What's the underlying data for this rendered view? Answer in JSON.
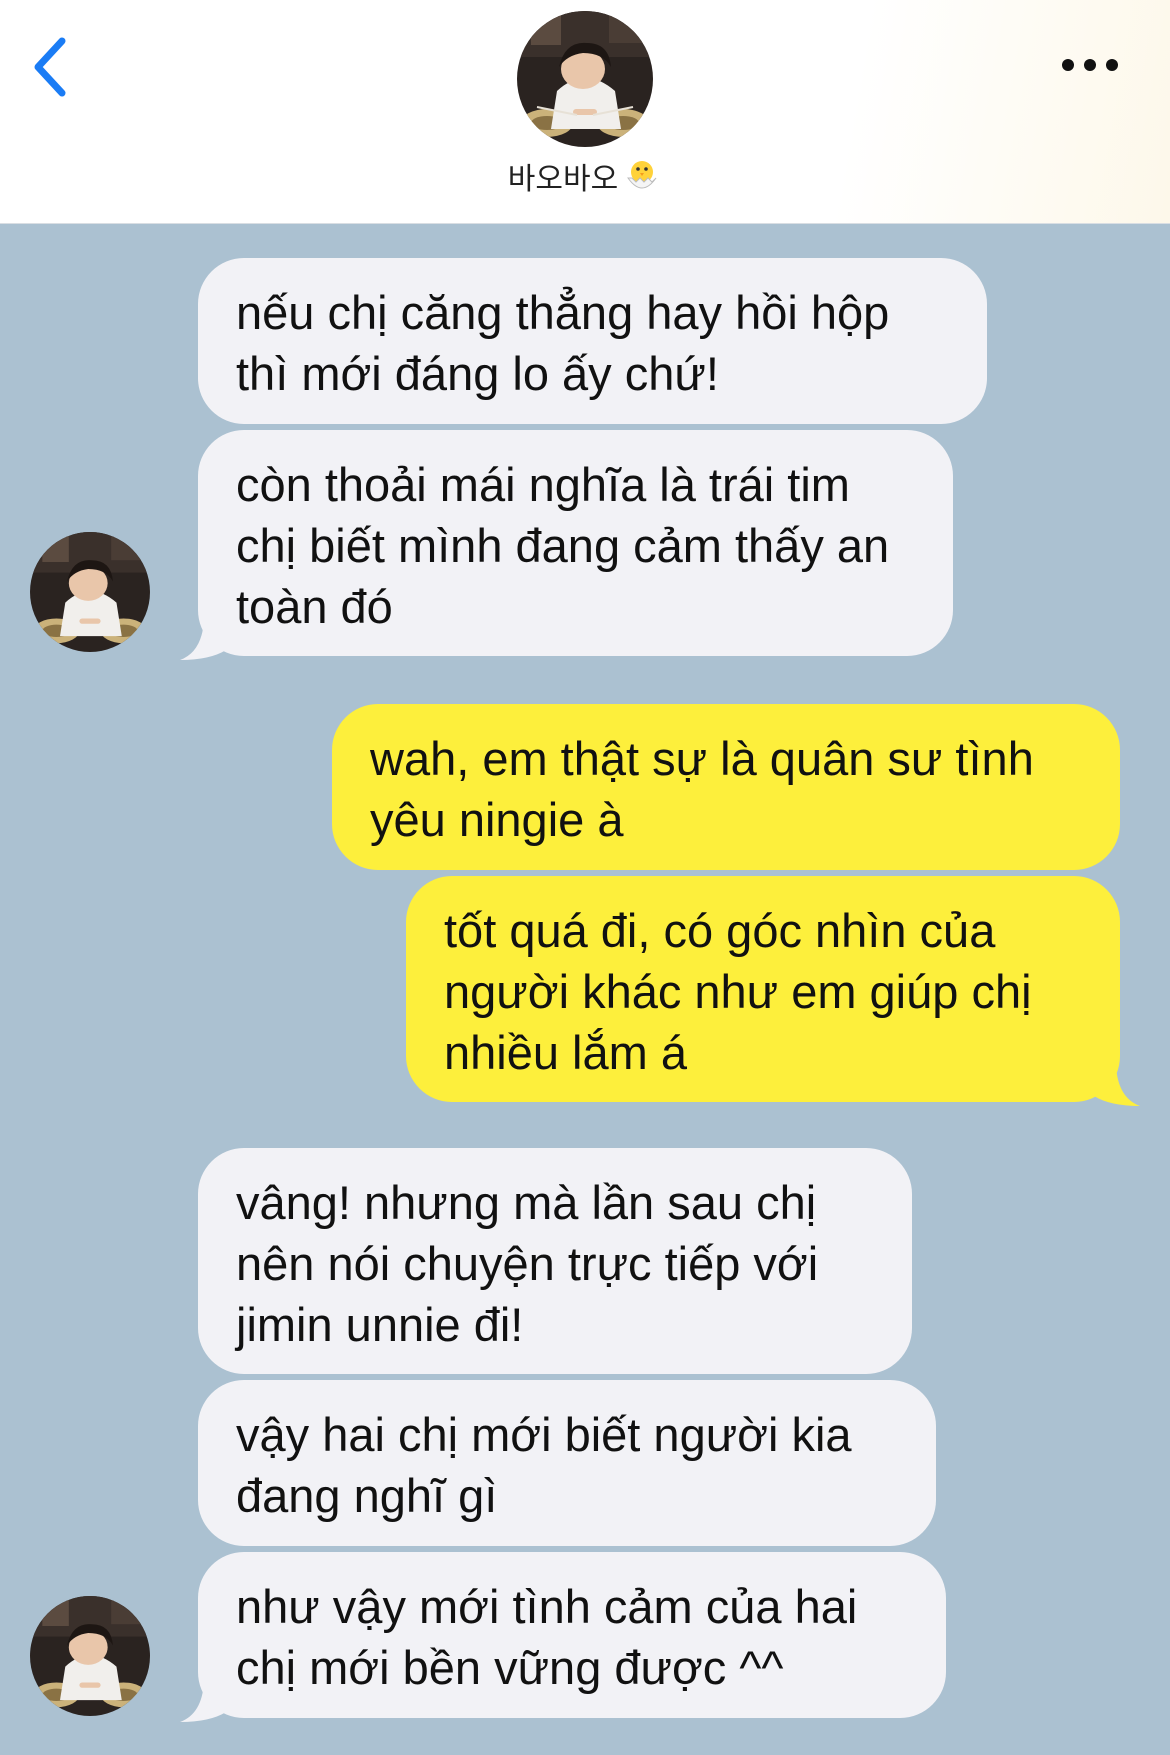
{
  "header": {
    "back_icon": "chevron-left-icon",
    "more_icon": "ellipsis-icon",
    "contact_name": "바오바오",
    "name_emoji": "hatching-chick-icon",
    "accent_color": "#1a7cf5"
  },
  "chat": {
    "background_color": "#abc1d1",
    "incoming_color": "#f2f2f6",
    "outgoing_color": "#fdef3c",
    "messages": [
      {
        "direction": "incoming",
        "text": "nếu chị căng thẳng hay hồi hộp thì mới đáng lo ấy chứ!"
      },
      {
        "direction": "incoming",
        "text": "còn thoải mái nghĩa là trái tim chị biết mình đang cảm thấy an toàn đó"
      },
      {
        "direction": "outgoing",
        "text": "wah, em thật sự là quân sư tình yêu ningie à"
      },
      {
        "direction": "outgoing",
        "text": "tốt quá đi, có góc nhìn của người khác như em giúp chị nhiều lắm á"
      },
      {
        "direction": "incoming",
        "text": "vâng! nhưng mà lần sau chị nên nói chuyện trực tiếp với jimin unnie đi!"
      },
      {
        "direction": "incoming",
        "text": "vậy hai chị mới biết người kia đang nghĩ gì"
      },
      {
        "direction": "incoming",
        "text": "như vậy mới tình cảm của hai chị mới bền vững được ^^"
      }
    ]
  }
}
